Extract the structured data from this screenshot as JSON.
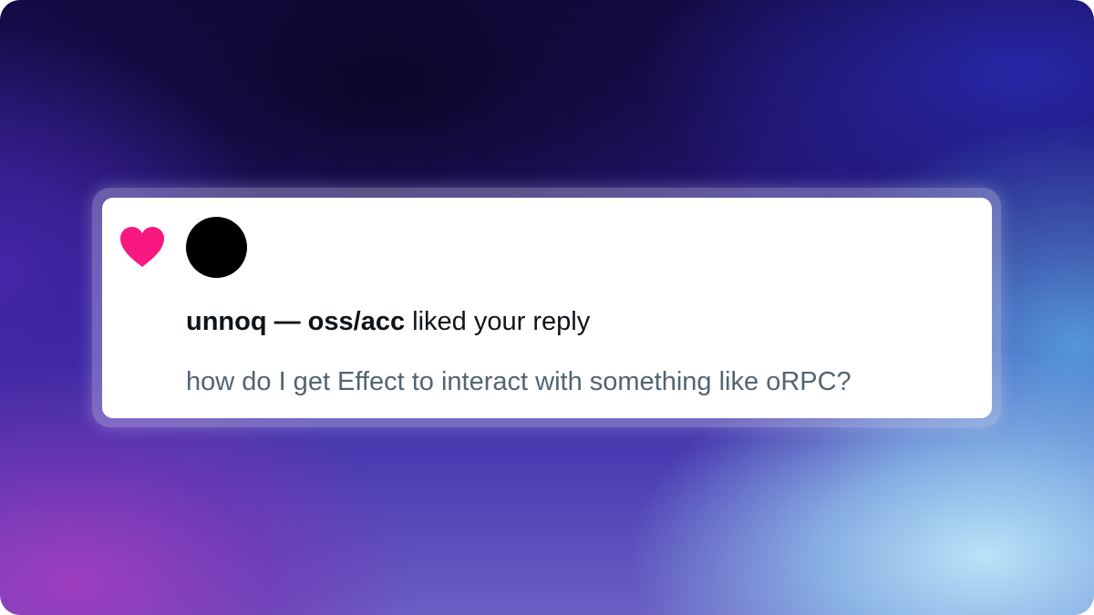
{
  "notification": {
    "type_icon": "heart-icon",
    "user_display": "unnoq — oss/acc",
    "action_text": " liked your reply",
    "reply_text": "how do I get Effect to interact with something like oRPC?"
  },
  "colors": {
    "heart": "#f91880",
    "avatar": "#000000",
    "primary_text": "#0f1419",
    "secondary_text": "#536471",
    "card_background": "#ffffff"
  }
}
